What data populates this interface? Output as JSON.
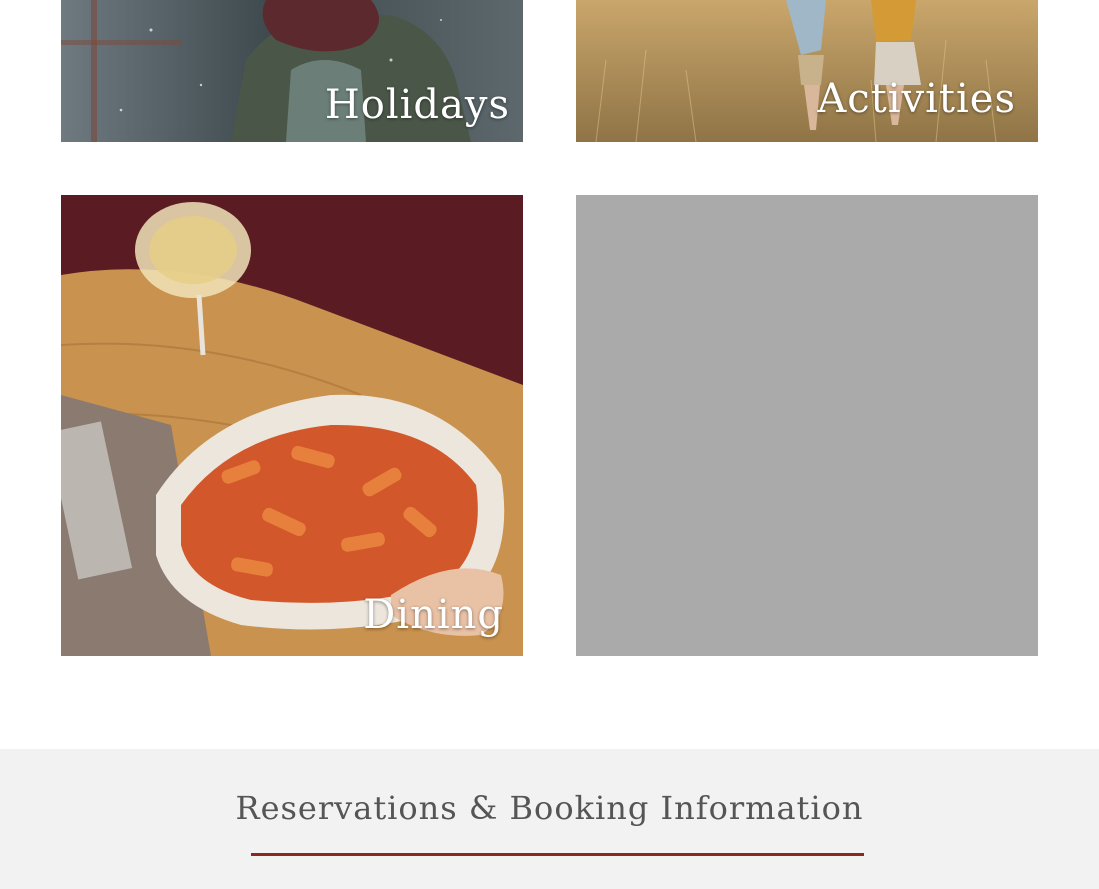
{
  "cards": {
    "holidays": {
      "label": "Holidays"
    },
    "activities": {
      "label": "Activities"
    },
    "dining": {
      "label": "Dining"
    }
  },
  "reservations": {
    "title": "Reservations & Booking Information"
  },
  "colors": {
    "placeholder": "#aaaaaa",
    "section_bg": "#f2f2f2",
    "accent_rule": "#8a2a1c",
    "heading_text": "#555555"
  }
}
